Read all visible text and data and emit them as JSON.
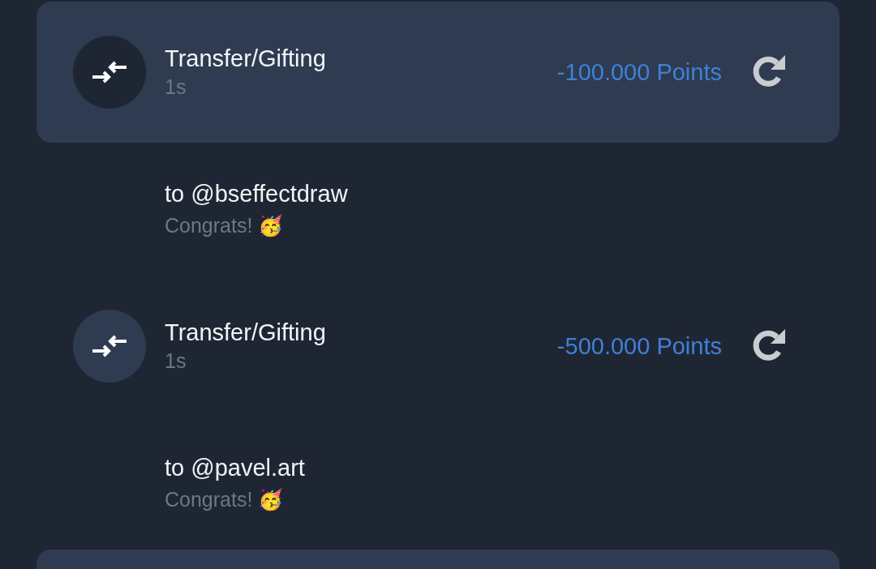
{
  "transactions": [
    {
      "selected": true,
      "title": "Transfer/Gifting",
      "time": "1s",
      "amount": "-100.000 Points",
      "recipient": "to @bseffectdraw",
      "message": "Congrats! 🥳"
    },
    {
      "selected": false,
      "title": "Transfer/Gifting",
      "time": "1s",
      "amount": "-500.000 Points",
      "recipient": "to @pavel.art",
      "message": "Congrats! 🥳"
    },
    {
      "selected": true
    }
  ]
}
